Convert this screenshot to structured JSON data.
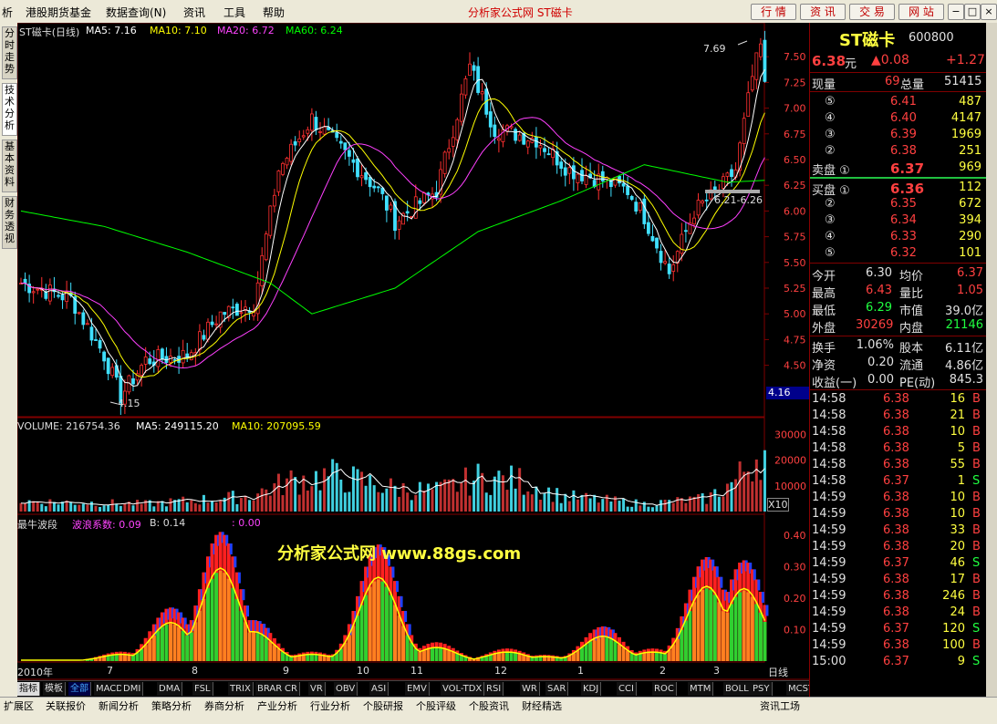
{
  "menu": {
    "items": [
      "析",
      "港股期货基金",
      "数据查询(N)",
      "资讯",
      "工具",
      "帮助"
    ],
    "title": "分析家公式网 ST磁卡",
    "buttons": [
      "行 情",
      "资 讯",
      "交 易",
      "网 站"
    ],
    "window_controls": [
      "−",
      "□",
      "×"
    ]
  },
  "left_tabs": [
    "分时走势",
    "技术分析",
    "基本资料",
    "财务透视"
  ],
  "main_chart": {
    "header": {
      "name": "ST磁卡(日线)",
      "ma5": "MA5: 7.16",
      "ma10": "MA10: 7.10",
      "ma20": "MA20: 6.72",
      "ma60": "MA60: 6.24"
    },
    "high_label": "7.69",
    "low_label": "4.15",
    "range_label": "6.21-6.26",
    "cursor_price": "4.16",
    "price_ticks": [
      "7.50",
      "7.25",
      "7.00",
      "6.75",
      "6.50",
      "6.25",
      "6.00",
      "5.75",
      "5.50",
      "5.25",
      "5.00",
      "4.75",
      "4.50"
    ]
  },
  "volume": {
    "header": {
      "name": "VOLUME: 216754.36",
      "ma5": "MA5: 249115.20",
      "ma10": "MA10: 207095.59"
    },
    "ticks": [
      "30000",
      "20000",
      "10000"
    ],
    "unit": "X10"
  },
  "indicator": {
    "header": {
      "name": "最牛波段",
      "wave": "波浪系数: 0.09",
      "b": "B: 0.14",
      "extra": ": 0.00"
    },
    "ticks": [
      "0.40",
      "0.30",
      "0.20",
      "0.10"
    ],
    "watermark": "分析家公式网 www.88gs.com"
  },
  "time_axis": {
    "labels": [
      "2010年",
      "7",
      "8",
      "9",
      "10",
      "11",
      "12",
      "1",
      "2",
      "3"
    ],
    "period": "日线"
  },
  "indicator_tabs": [
    "指标",
    "模板",
    "全部",
    "MACD",
    "DMI",
    "DMA",
    "FSL",
    "TRIX",
    "BRAR",
    "CR",
    "VR",
    "OBV",
    "ASI",
    "EMV",
    "VOL-TDX",
    "RSI",
    "WR",
    "SAR",
    "KDJ",
    "CCI",
    "ROC",
    "MTM",
    "BOLL",
    "PSY",
    "MCST"
  ],
  "bottom_tabs": [
    "扩展区",
    "关联报价",
    "新闻分析",
    "策略分析",
    "券商分析",
    "产业分析",
    "行业分析",
    "个股研报",
    "个股评级",
    "个股资讯",
    "财经精选",
    "资讯工场"
  ],
  "quote": {
    "name": "ST磁卡",
    "code": "600800",
    "price": "6.38",
    "price_unit": "元",
    "change": "▲0.08",
    "pct": "+1.27",
    "current_vol_label": "现量",
    "current_vol": "69",
    "total_vol_label": "总量",
    "total_vol": "51415",
    "sells": [
      {
        "lvl": "⑤",
        "price": "6.41",
        "vol": "487"
      },
      {
        "lvl": "④",
        "price": "6.40",
        "vol": "4147"
      },
      {
        "lvl": "③",
        "price": "6.39",
        "vol": "1969"
      },
      {
        "lvl": "②",
        "price": "6.38",
        "vol": "251"
      },
      {
        "lvl": "卖盘 ①",
        "price": "6.37",
        "vol": "969"
      }
    ],
    "buys": [
      {
        "lvl": "买盘 ①",
        "price": "6.36",
        "vol": "112"
      },
      {
        "lvl": "②",
        "price": "6.35",
        "vol": "672"
      },
      {
        "lvl": "③",
        "price": "6.34",
        "vol": "394"
      },
      {
        "lvl": "④",
        "price": "6.33",
        "vol": "290"
      },
      {
        "lvl": "⑤",
        "price": "6.32",
        "vol": "101"
      }
    ],
    "stats": [
      {
        "l1": "今开",
        "v1": "6.30",
        "l2": "均价",
        "v2": "6.37",
        "c1": "white",
        "c2": "red"
      },
      {
        "l1": "最高",
        "v1": "6.43",
        "l2": "量比",
        "v2": "1.05",
        "c1": "red",
        "c2": "red"
      },
      {
        "l1": "最低",
        "v1": "6.29",
        "l2": "市值",
        "v2": "39.0亿",
        "c1": "green",
        "c2": "white"
      },
      {
        "l1": "外盘",
        "v1": "30269",
        "l2": "内盘",
        "v2": "21146",
        "c1": "red",
        "c2": "green"
      }
    ],
    "stats2": [
      {
        "l1": "换手",
        "v1": "1.06%",
        "l2": "股本",
        "v2": "6.11亿"
      },
      {
        "l1": "净资",
        "v1": "0.20",
        "l2": "流通",
        "v2": "4.86亿"
      },
      {
        "l1": "收益(一)",
        "v1": "0.00",
        "l2": "PE(动)",
        "v2": "845.3"
      }
    ],
    "ticks": [
      {
        "t": "14:58",
        "p": "6.38",
        "v": "16",
        "s": "B"
      },
      {
        "t": "14:58",
        "p": "6.38",
        "v": "21",
        "s": "B"
      },
      {
        "t": "14:58",
        "p": "6.38",
        "v": "10",
        "s": "B"
      },
      {
        "t": "14:58",
        "p": "6.38",
        "v": "5",
        "s": "B"
      },
      {
        "t": "14:58",
        "p": "6.38",
        "v": "55",
        "s": "B"
      },
      {
        "t": "14:58",
        "p": "6.37",
        "v": "1",
        "s": "S"
      },
      {
        "t": "14:59",
        "p": "6.38",
        "v": "10",
        "s": "B"
      },
      {
        "t": "14:59",
        "p": "6.38",
        "v": "10",
        "s": "B"
      },
      {
        "t": "14:59",
        "p": "6.38",
        "v": "33",
        "s": "B"
      },
      {
        "t": "14:59",
        "p": "6.38",
        "v": "20",
        "s": "B"
      },
      {
        "t": "14:59",
        "p": "6.37",
        "v": "46",
        "s": "S"
      },
      {
        "t": "14:59",
        "p": "6.38",
        "v": "17",
        "s": "B"
      },
      {
        "t": "14:59",
        "p": "6.38",
        "v": "246",
        "s": "B"
      },
      {
        "t": "14:59",
        "p": "6.38",
        "v": "24",
        "s": "B"
      },
      {
        "t": "14:59",
        "p": "6.37",
        "v": "120",
        "s": "S"
      },
      {
        "t": "14:59",
        "p": "6.38",
        "v": "100",
        "s": "B"
      },
      {
        "t": "15:00",
        "p": "6.37",
        "v": "9",
        "s": "S"
      }
    ]
  },
  "colors": {
    "up": "#ff3030",
    "down": "#40e0ff",
    "ma5": "#ffffff",
    "ma10": "#ffff00",
    "ma20": "#ff40ff",
    "ma60": "#00ff00",
    "bg": "#000000",
    "frame": "#800000"
  }
}
